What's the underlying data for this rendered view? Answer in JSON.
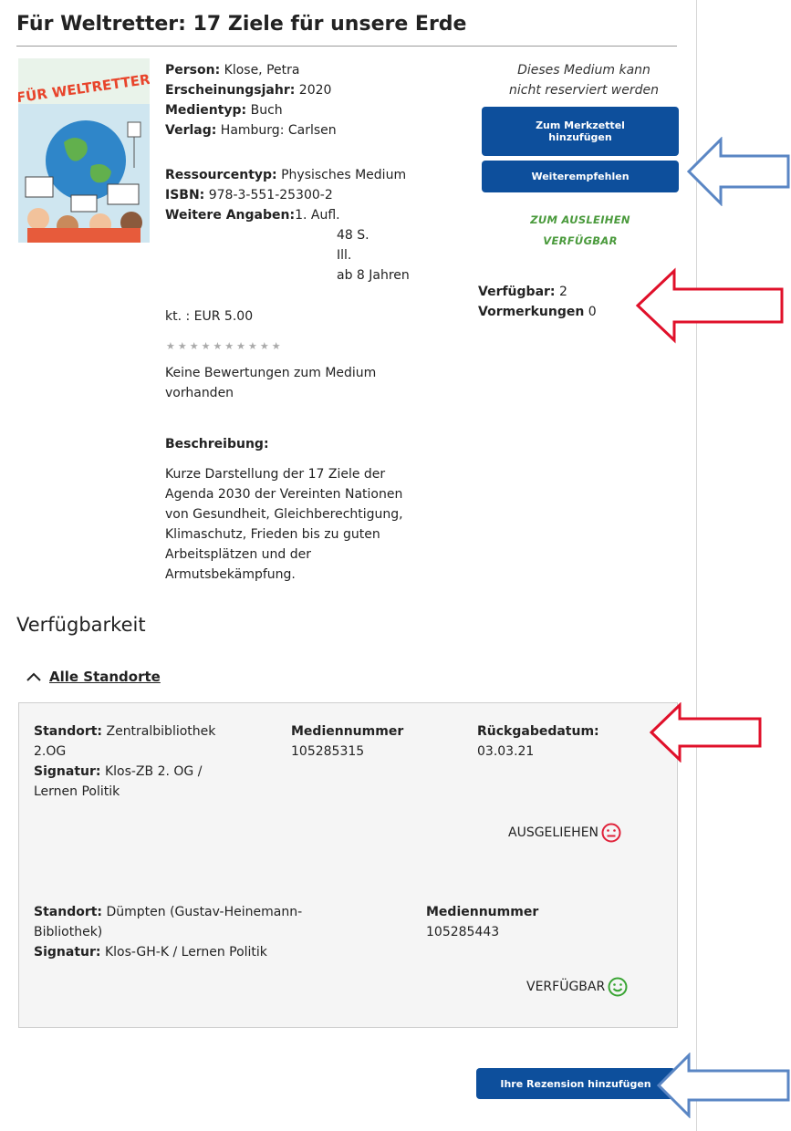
{
  "title": "Für Weltretter: 17 Ziele für unsere Erde",
  "cover": {
    "text": "FÜR WELTRETTER"
  },
  "details": {
    "person_label": "Person:",
    "person_value": "Klose, Petra",
    "year_label": "Erscheinungsjahr:",
    "year_value": "2020",
    "type_label": "Medientyp:",
    "type_value": "Buch",
    "publisher_label": "Verlag:",
    "publisher_value": "Hamburg: Carlsen",
    "resource_label": "Ressourcentyp:",
    "resource_value": "Physisches Medium",
    "isbn_label": "ISBN:",
    "isbn_value": "978-3-551-25300-2",
    "more_label": "Weitere Angaben:",
    "more_lines": [
      "1. Aufl.",
      "48 S.",
      "Ill.",
      "ab 8 Jahren"
    ],
    "price": "kt. : EUR 5.00"
  },
  "rating": {
    "stars": "★★★★★★★★★★",
    "none_line1": "Keine Bewertungen zum Medium",
    "none_line2": "vorhanden"
  },
  "description": {
    "label": "Beschreibung:",
    "lines": [
      "Kurze Darstellung der 17 Ziele der",
      "Agenda 2030 der Vereinten Nationen",
      "von Gesundheit, Gleichberechtigung,",
      "Klimaschutz, Frieden bis zu guten",
      "Arbeitsplätzen und der",
      "Armutsbekämpfung."
    ]
  },
  "actions": {
    "note_line1": "Dieses Medium kann",
    "note_line2": "nicht reserviert werden",
    "merkzettel_line1": "Zum Merkzettel",
    "merkzettel_line2": "hinzufügen",
    "recommend": "Weiterempfehlen",
    "available_line1": "ZUM AUSLEIHEN",
    "available_line2": "VERFÜGBAR",
    "verfuegbar_label": "Verfügbar:",
    "verfuegbar_value": "2",
    "vormerkungen_label": "Vormerkungen",
    "vormerkungen_value": "0"
  },
  "availability": {
    "heading": "Verfügbarkeit",
    "toggle_icon": "chevron-up-icon",
    "all_locations": "Alle Standorte",
    "items": [
      {
        "standort_label": "Standort:",
        "standort_line1": "Zentralbibliothek",
        "standort_line2": "2.OG",
        "signatur_label": "Signatur:",
        "signatur_line1": "Klos-ZB 2. OG /",
        "signatur_line2": "Lernen Politik",
        "mediennummer_label": "Mediennummer",
        "mediennummer_value": "105285315",
        "rueckgabe_label": "Rückgabedatum:",
        "rueckgabe_value": "03.03.21",
        "status": "AUSGELIEHEN",
        "status_icon": "sad-face-icon",
        "status_color": "#e0223a"
      },
      {
        "standort_label": "Standort:",
        "standort_line1": "Dümpten (Gustav-Heinemann-",
        "standort_line2": "Bibliothek)",
        "signatur_label": "Signatur:",
        "signatur_line1": "Klos-GH-K / Lernen Politik",
        "mediennummer_label": "Mediennummer",
        "mediennummer_value": "105285443",
        "status": "VERFÜGBAR",
        "status_icon": "happy-face-icon",
        "status_color": "#3aa534"
      }
    ]
  },
  "review_button": "Ihre Rezension hinzufügen",
  "colors": {
    "primary": "#0d4f9c",
    "green": "#4a9a3c",
    "annotation_red": "#e0102a",
    "annotation_blue": "#5a86c4"
  }
}
